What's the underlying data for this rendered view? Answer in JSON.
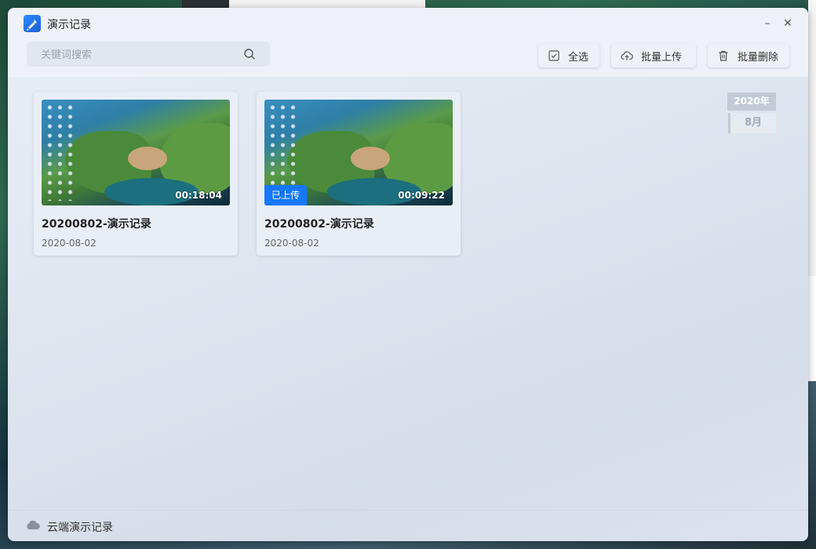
{
  "window": {
    "title": "演示记录",
    "minimize_glyph": "–",
    "close_glyph": "✕"
  },
  "search": {
    "placeholder": "关键词搜索",
    "value": ""
  },
  "toolbar": {
    "select_all_label": "全选",
    "batch_upload_label": "批量上传",
    "batch_delete_label": "批量删除"
  },
  "records": [
    {
      "title": "20200802-演示记录",
      "date": "2020-08-02",
      "duration": "00:18:04",
      "uploaded": false,
      "badge": ""
    },
    {
      "title": "20200802-演示记录",
      "date": "2020-08-02",
      "duration": "00:09:22",
      "uploaded": true,
      "badge": "已上传"
    }
  ],
  "timeline": {
    "year": "2020年",
    "month": "8月"
  },
  "footer": {
    "label": "云端演示记录"
  },
  "colors": {
    "accent": "#1677ff",
    "window_bg": "#e3e9f2"
  }
}
